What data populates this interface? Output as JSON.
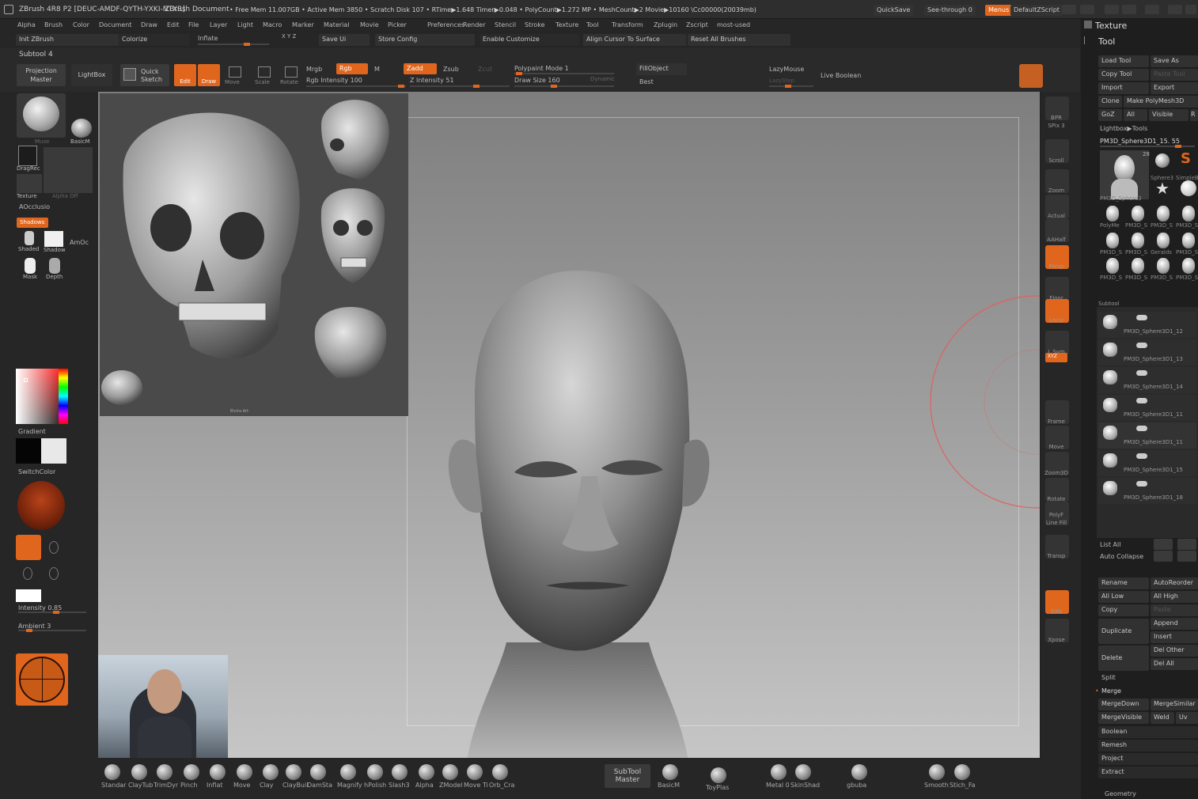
{
  "app": {
    "title": "ZBrush 4R8 P2 [DEUC-AMDF-QYTH-YXKI-NTXR]",
    "document": "ZBrush Document",
    "stats": "• Free Mem 11.007GB • Active Mem 3850 • Scratch Disk 107 • RTime▶1.648 Timer▶0.048 • PolyCount▶1.272 MP • MeshCount▶2 Movie▶10160 \\Cc00000(20039mb)",
    "quicksave": "QuickSave",
    "seethrough": "See-through 0",
    "menus": "Menus",
    "defaultzscript": "DefaultZScript"
  },
  "menu": [
    "Alpha",
    "Brush",
    "Color",
    "Document",
    "Draw",
    "Edit",
    "File",
    "Layer",
    "Light",
    "Macro",
    "Marker",
    "Material",
    "Movie",
    "Picker",
    "Preferences",
    "Render",
    "Stencil",
    "Stroke",
    "Texture",
    "Tool",
    "Transform",
    "Zplugin",
    "Zscript",
    "most-used"
  ],
  "ops": {
    "init": "Init ZBrush",
    "colorize": "Colorize",
    "inflate": "Inflate",
    "xyz": "X Y Z",
    "saveui": "Save Ui",
    "storeconfig": "Store Config",
    "enablecustomize": "Enable Customize",
    "aligncursor": "Align Cursor To Surface",
    "resetbrushes": "Reset All Brushes"
  },
  "subtool_label": "Subtool 4",
  "toolbar": {
    "projection": "Projection Master",
    "lightbox": "LightBox",
    "quicksketch": "Quick Sketch",
    "edit": "Edit",
    "draw": "Draw",
    "move": "Move",
    "scale": "Scale",
    "rotate": "Rotate",
    "mrgb": "Mrgb",
    "rgb": "Rgb",
    "m": "M",
    "rgbintensity": "Rgb Intensity 100",
    "zadd": "Zadd",
    "zsub": "Zsub",
    "zcut": "Zcut",
    "zintensity": "Z Intensity 51",
    "polypaint": "Polypaint Mode 1",
    "drawsize": "Draw Size 160",
    "dynamic": "Dynamic",
    "fillobject": "FillObject",
    "best": "Best",
    "lazymouse": "LazyMouse",
    "lazystep": "LazyStep",
    "liveboolean": "Live Boolean"
  },
  "left": {
    "muse": "Muse",
    "basicm": "BasicM",
    "dragrec": "DragRec",
    "texture": "Texture",
    "alphaoff": "Alpha Off",
    "aocclusion": "AOcclusio",
    "shadows": "Shadows",
    "shaded": "Shaded",
    "shadow": "Shadow",
    "amoc": "AmOc",
    "mask": "Mask",
    "depth": "Depth",
    "gradient": "Gradient",
    "switchcolor": "SwitchColor",
    "intensity": "Intensity 0.85",
    "ambient": "Ambient 3"
  },
  "right": [
    "BPR",
    "SPix 3",
    "Scroll",
    "Zoom",
    "Actual",
    "AAHalf",
    "Persp",
    "Floor",
    "Local",
    "L.Sym",
    "XYZ",
    "",
    "Frame",
    "Move",
    "Zoom3D",
    "Rotate",
    "Line Fill",
    "PolyF",
    "Transp",
    "Solo",
    "Xpose"
  ],
  "bottom": {
    "brushes": [
      "Standar",
      "ClayTub",
      "TrimDyr",
      "Pinch",
      "Inflat",
      "Move",
      "Clay",
      "ClayBuil",
      "DamSta",
      "Magnify",
      "hPolish",
      "Slash3",
      "Alpha",
      "ZModel",
      "Move Ti",
      "Orb_Cra"
    ],
    "subtoolmaster": "SubTool Master",
    "basicm": "BasicM",
    "toyplas": "ToyPlas",
    "metal": "Metal 0",
    "skinshade": "SkinShad",
    "gbuba": "gbuba",
    "smooth": "Smooth",
    "stitchfa": "Stich_Fa"
  },
  "panel": {
    "texture": "Texture",
    "tool": "Tool",
    "loadtool": "Load Tool",
    "saveas": "Save As",
    "copytool": "Copy Tool",
    "pastetool": "Paste Tool",
    "import": "Import",
    "export": "Export",
    "clone": "Clone",
    "makepolymesh": "Make PolyMesh3D",
    "goz": "GoZ",
    "all": "All",
    "visible": "Visible",
    "r": "R",
    "lightboxtools": "Lightbox▶Tools",
    "pm3d": "PM3D_Sphere3D1_15.  55",
    "thumbcount": "28",
    "thumbs": [
      "PM3D_Sphere3",
      "Sphere3",
      "SimpleB",
      "PolyMe",
      "PM3D_S",
      "PM3D_S",
      "PM3D_S",
      "PM3D_S",
      "PM3D_S",
      "Geralds",
      "PM3D_S",
      "PM3D_S",
      "PM3D_S",
      "PM3D_S",
      "PM3D_S"
    ],
    "subtool": "Subtool",
    "subtools": [
      "PM3D_Sphere3D1_12",
      "PM3D_Sphere3D1_13",
      "PM3D_Sphere3D1_14",
      "PM3D_Sphere3D1_11",
      "PM3D_Sphere3D1_11",
      "PM3D_Sphere3D1_15",
      "PM3D_Sphere3D1_18"
    ],
    "listall": "List All",
    "autocollapse": "Auto Collapse",
    "rename": "Rename",
    "autoreorder": "AutoReorder",
    "alllow": "All Low",
    "allhigh": "All High",
    "copy": "Copy",
    "paste": "Paste",
    "duplicate": "Duplicate",
    "append": "Append",
    "insert": "Insert",
    "delete": "Delete",
    "delother": "Del Other",
    "delall": "Del All",
    "split": "Split",
    "merge": "Merge",
    "mergedown": "MergeDown",
    "mergesimilar": "MergeSimilar",
    "mergevisible": "MergeVisible",
    "weld": "Weld",
    "uv": "Uv",
    "boolean": "Boolean",
    "remesh": "Remesh",
    "project": "Project",
    "extract": "Extract",
    "geometry": "Geometry"
  },
  "ref": {
    "caption": "Elvira Art"
  },
  "colors": {
    "accent": "#e0661d",
    "panel": "#262626",
    "viewport_top": "#7e7e7e",
    "viewport_bottom": "#c6c6c6",
    "cursor_ring": "#e06060"
  }
}
